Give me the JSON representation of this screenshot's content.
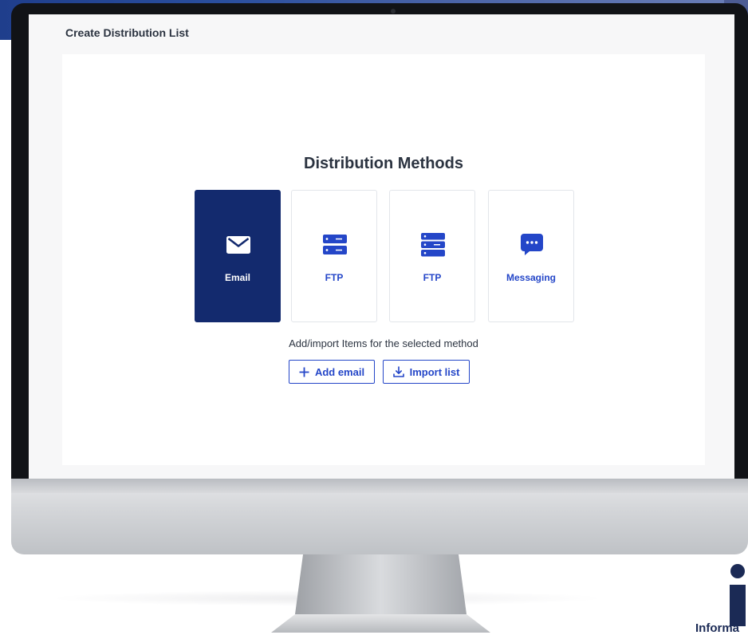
{
  "page": {
    "title": "Create Distribution List"
  },
  "distribution": {
    "section_title": "Distribution Methods",
    "methods": [
      {
        "label": "Email",
        "icon": "envelope-icon",
        "selected": true
      },
      {
        "label": "FTP",
        "icon": "server-icon",
        "selected": false
      },
      {
        "label": "FTP",
        "icon": "server-icon",
        "selected": false
      },
      {
        "label": "Messaging",
        "icon": "chat-bubble-icon",
        "selected": false
      }
    ],
    "helper_text": "Add/import Items for the selected method",
    "add_button_label": "Add email",
    "import_button_label": "Import list"
  },
  "branding": {
    "logo_text": "Informa"
  },
  "colors": {
    "accent": "#2446c8",
    "selected_tile": "#132a6e",
    "text_dark": "#2b3340",
    "background_band": "#1f3e8c"
  }
}
